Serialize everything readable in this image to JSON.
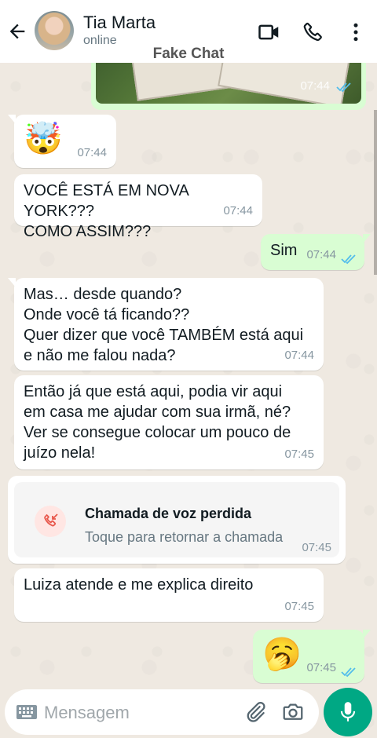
{
  "header": {
    "contact_name": "Tia Marta",
    "status": "online",
    "overlay_label": "Fake Chat"
  },
  "image_message": {
    "time": "07:44"
  },
  "messages": [
    {
      "direction": "in",
      "text": "🤯",
      "time": "07:44"
    },
    {
      "direction": "in",
      "lines": [
        "VOCÊ ESTÁ EM NOVA YORK???",
        "COMO ASSIM???"
      ],
      "time": "07:44"
    },
    {
      "direction": "out",
      "text": "Sim",
      "time": "07:44"
    },
    {
      "direction": "in",
      "lines": [
        "Mas… desde quando?",
        "Onde você tá ficando??",
        "Quer dizer que você TAMBÉM está aqui",
        "e não me falou nada?"
      ],
      "time": "07:44"
    },
    {
      "direction": "in",
      "lines": [
        "Então já que está aqui, podia vir aqui",
        "em casa me ajudar com sua irmã, né?",
        "Ver se consegue colocar um pouco de",
        "juízo nela!"
      ],
      "time": "07:45"
    },
    {
      "direction": "in",
      "text": "Luiza atende e me explica direito",
      "time": "07:45"
    },
    {
      "direction": "out",
      "text": "🥱",
      "time": "07:45"
    }
  ],
  "missed_call": {
    "title": "Chamada de voz perdida",
    "subtitle": "Toque para retornar a chamada",
    "time": "07:45"
  },
  "composer": {
    "placeholder": "Mensagem"
  },
  "colors": {
    "outgoing_bubble": "#d9fdd3",
    "incoming_bubble": "#ffffff",
    "accent": "#00a884",
    "read_ticks": "#53bdeb",
    "missed_call": "#e8574b"
  },
  "icons": [
    "back-arrow-icon",
    "video-call-icon",
    "voice-call-icon",
    "more-menu-icon",
    "keyboard-icon",
    "attach-icon",
    "camera-icon",
    "mic-icon",
    "missed-call-icon",
    "read-ticks-icon"
  ]
}
